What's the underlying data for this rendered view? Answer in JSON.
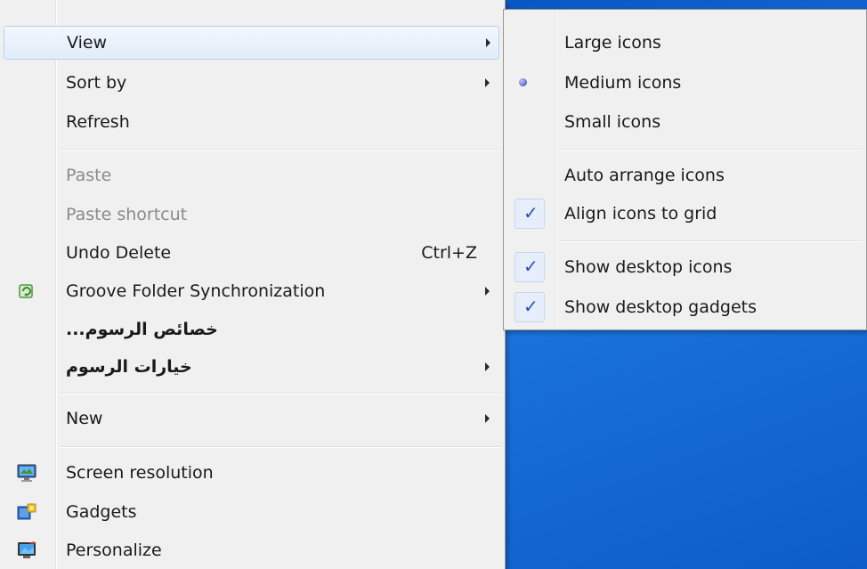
{
  "main_menu": {
    "items": [
      {
        "label": "View"
      },
      {
        "label": "Sort by"
      },
      {
        "label": "Refresh"
      },
      {
        "label": "Paste"
      },
      {
        "label": "Paste shortcut"
      },
      {
        "label": "Undo Delete",
        "shortcut": "Ctrl+Z"
      },
      {
        "label": "Groove Folder Synchronization",
        "icon": "groove-icon"
      },
      {
        "label": "...خصائص الرسوم"
      },
      {
        "label": "خيارات الرسوم"
      },
      {
        "label": "New"
      },
      {
        "label": "Screen resolution",
        "icon": "screen-resolution-icon"
      },
      {
        "label": "Gadgets",
        "icon": "gadgets-icon"
      },
      {
        "label": "Personalize",
        "icon": "personalize-icon"
      }
    ]
  },
  "view_submenu": {
    "items": [
      {
        "label": "Large icons"
      },
      {
        "label": "Medium icons",
        "state": "selected"
      },
      {
        "label": "Small icons"
      },
      {
        "label": "Auto arrange icons"
      },
      {
        "label": "Align icons to grid",
        "state": "checked"
      },
      {
        "label": "Show desktop icons",
        "state": "checked"
      },
      {
        "label": "Show desktop gadgets",
        "state": "checked"
      }
    ]
  },
  "colors": {
    "menu_bg": "#f0f0f0",
    "highlight": "#e1ecfa",
    "desktop": "#1f6ed0",
    "disabled_text": "#8b8b8b"
  }
}
